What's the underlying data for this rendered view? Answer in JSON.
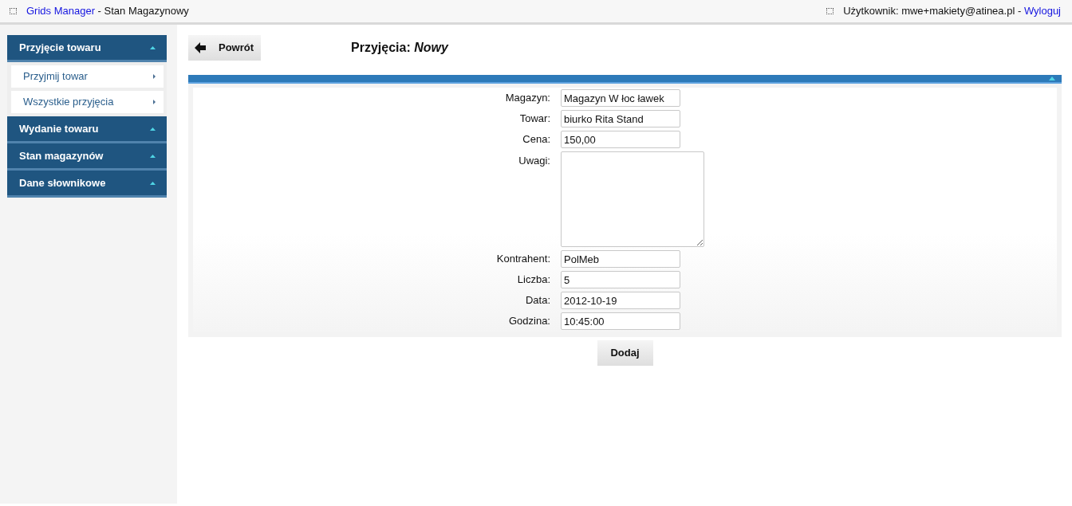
{
  "header": {
    "app_link": "Grids Manager",
    "app_title": "- Stan Magazynowy",
    "user_label": "Użytkownik: mwe+makiety@atinea.pl -",
    "logout_link": "Wyloguj"
  },
  "sidebar": {
    "sections": [
      {
        "title": "Przyjęcie towaru",
        "items": [
          {
            "label": "Przyjmij towar"
          },
          {
            "label": "Wszystkie przyjęcia"
          }
        ]
      },
      {
        "title": "Wydanie towaru"
      },
      {
        "title": "Stan magazynów"
      },
      {
        "title": "Dane słownikowe"
      }
    ]
  },
  "back_button": "Powrót",
  "page_title": "Przyjęcia: *Nowy*",
  "form": {
    "fields": [
      {
        "label": "Magazyn:",
        "kind": "input",
        "value": "Magazyn W łoc ławek"
      },
      {
        "label": "Towar:",
        "kind": "input",
        "value": "biurko Rita Stand"
      },
      {
        "label": "Cena:",
        "kind": "input",
        "value": "150,00"
      },
      {
        "label": "Uwagi:",
        "kind": "textarea"
      },
      {
        "label": "Kontrahent:",
        "kind": "input",
        "value": "PolMeb"
      },
      {
        "label": "Liczba:",
        "kind": "input",
        "value": "5"
      },
      {
        "label": "Data:",
        "kind": "input",
        "value": "2012-10-19"
      },
      {
        "label": "Godzina:",
        "kind": "input",
        "value": "10:45:00"
      }
    ],
    "submit": "Dodaj"
  }
}
